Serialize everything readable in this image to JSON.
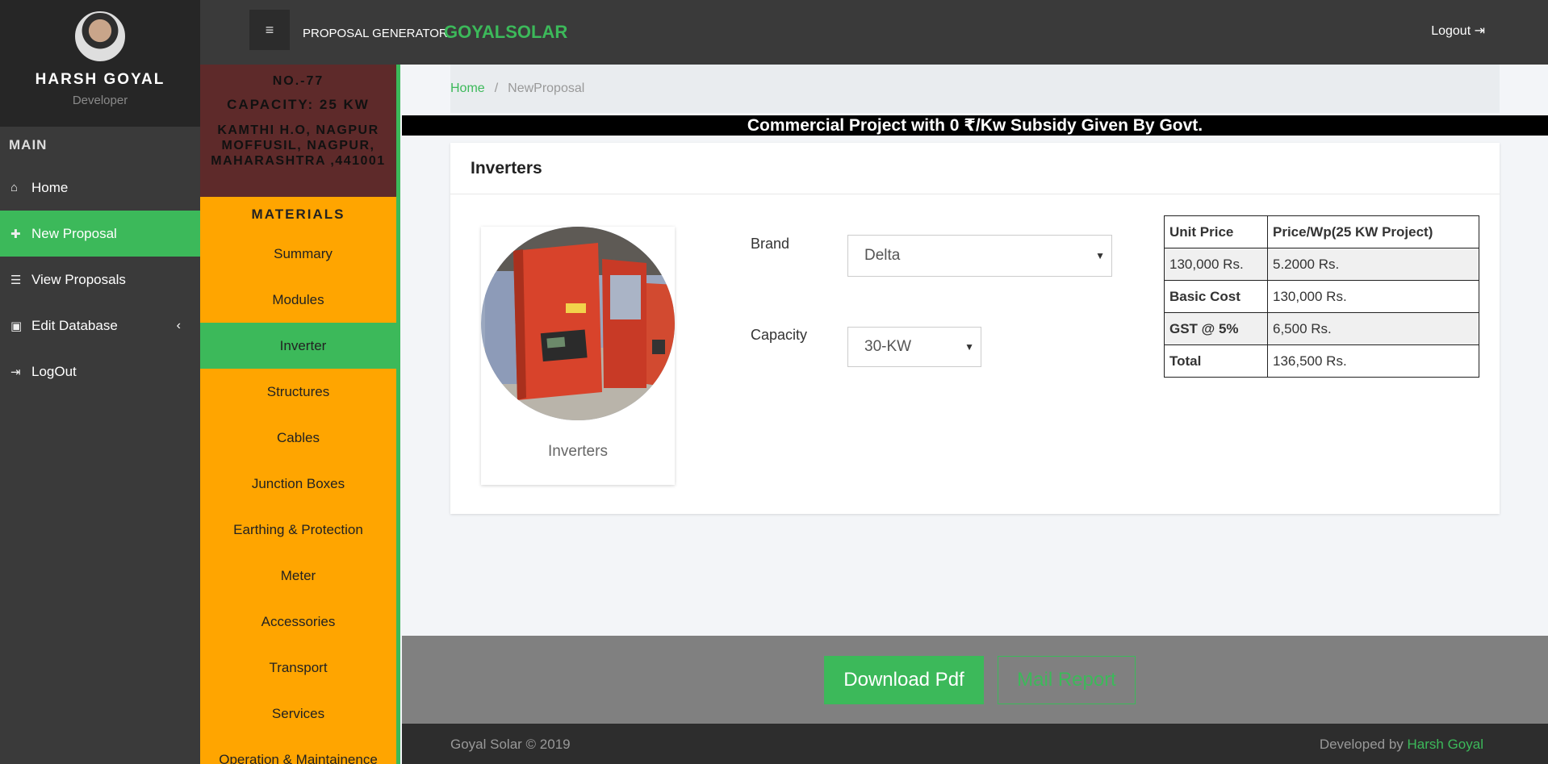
{
  "sidebar": {
    "profile": {
      "name": "HARSH GOYAL",
      "role": "Developer"
    },
    "section_title": "MAIN",
    "items": [
      {
        "label": "Home",
        "icon": "home-icon",
        "glyph": "⌂"
      },
      {
        "label": "New Proposal",
        "icon": "plus-icon",
        "glyph": "✚"
      },
      {
        "label": "View Proposals",
        "icon": "database-icon",
        "glyph": "☰"
      },
      {
        "label": "Edit Database",
        "icon": "edit-icon",
        "glyph": "▣"
      },
      {
        "label": "LogOut",
        "icon": "sign-out-icon",
        "glyph": "⇥"
      }
    ],
    "edit_chevron": "‹"
  },
  "header": {
    "menu_glyph": "≡",
    "brand_small": "PROPOSAL GENERATOR",
    "brand_big": "GOYALSOLAR",
    "logout": "Logout ⇥"
  },
  "proposal": {
    "number": "NO.-77",
    "capacity": "CAPACITY: 25 KW",
    "address": "KAMTHI H.O, NAGPUR MOFFUSIL, NAGPUR, MAHARASHTRA ,441001"
  },
  "materials": {
    "title": "MATERIALS",
    "icon_glyph": "",
    "items": [
      {
        "label": "Summary",
        "has_icon": true
      },
      {
        "label": "Modules",
        "has_icon": false
      },
      {
        "label": "Inverter",
        "has_icon": true
      },
      {
        "label": "Structures",
        "has_icon": false
      },
      {
        "label": "Cables",
        "has_icon": false
      },
      {
        "label": "Junction Boxes",
        "has_icon": false
      },
      {
        "label": "Earthing & Protection",
        "has_icon": false
      },
      {
        "label": "Meter",
        "has_icon": false
      },
      {
        "label": "Accessories",
        "has_icon": false
      },
      {
        "label": "Transport",
        "has_icon": false
      },
      {
        "label": "Services",
        "has_icon": false
      },
      {
        "label": "Operation & Maintainence",
        "has_icon": false
      }
    ]
  },
  "breadcrumb": {
    "home": "Home",
    "separator": "/",
    "current": "NewProposal"
  },
  "banner": "Commercial Project with 0 ₹/Kw Subsidy Given By Govt.",
  "card": {
    "title": "Inverters",
    "product_label": "Inverters",
    "brand_label": "Brand",
    "brand_value": "Delta",
    "capacity_label": "Capacity",
    "capacity_value": "30-KW",
    "select_arrow": "▼",
    "price_table": {
      "headers": [
        "Unit Price",
        "Price/Wp(25 KW Project)"
      ],
      "rows": [
        [
          "130,000 Rs.",
          "5.2000 Rs."
        ],
        [
          "Basic Cost",
          "130,000 Rs."
        ],
        [
          "GST @ 5%",
          "6,500 Rs."
        ],
        [
          "Total",
          "136,500 Rs."
        ]
      ]
    }
  },
  "actions": {
    "download": "Download Pdf",
    "mail": "Mail Report"
  },
  "footer": {
    "copyright": "Goyal Solar © 2019",
    "dev_prefix": "Developed by ",
    "dev_name": "Harsh Goyal"
  },
  "colors": {
    "accent": "#3cb95a",
    "sidebar": "#3a3a3a",
    "materials": "#ffa500",
    "proposal_bg": "#5e2a2a"
  }
}
